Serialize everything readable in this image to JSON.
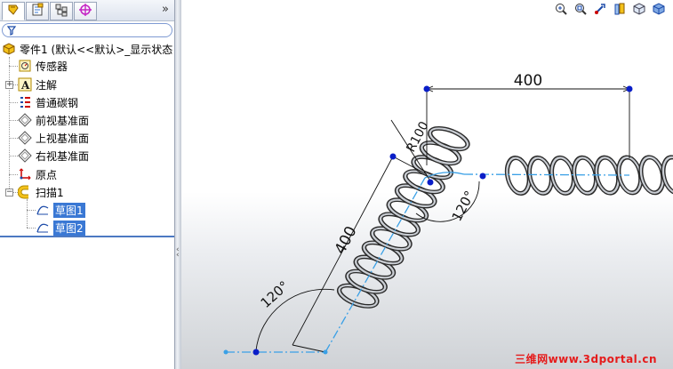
{
  "tabs": [
    {
      "name": "featuremanager-tab",
      "icon": "feature-tree-icon",
      "active": true
    },
    {
      "name": "propertymanager-tab",
      "icon": "property-manager-icon",
      "active": false
    },
    {
      "name": "configuration-tab",
      "icon": "configuration-manager-icon",
      "active": false
    },
    {
      "name": "dimxpert-tab",
      "icon": "crosshair-target-icon",
      "active": false
    }
  ],
  "tabs_more": "»",
  "tree": {
    "root": "零件1  (默认<<默认>_显示状态",
    "items": [
      {
        "label": "传感器",
        "icon": "sensor-icon"
      },
      {
        "label": "注解",
        "icon": "annotation-icon"
      },
      {
        "label": "普通碳钢",
        "icon": "material-icon"
      },
      {
        "label": "前视基准面",
        "icon": "plane-icon"
      },
      {
        "label": "上视基准面",
        "icon": "plane-icon"
      },
      {
        "label": "右视基准面",
        "icon": "plane-icon"
      },
      {
        "label": "原点",
        "icon": "origin-icon"
      },
      {
        "label": "扫描1",
        "icon": "sweep-icon"
      }
    ],
    "children": [
      {
        "label": "草图1",
        "icon": "sketch-icon",
        "selected": true
      },
      {
        "label": "草图2",
        "icon": "sketch-icon",
        "selected": true
      }
    ]
  },
  "view_toolbar": [
    "zoom-to-fit-icon",
    "zoom-area-icon",
    "previous-view-icon",
    "section-view-icon",
    "view-orientation-icon",
    "display-style-icon"
  ],
  "dimensions": {
    "top_length": "400",
    "angled_length": "400",
    "radius": "R100",
    "bend_angle": "120°",
    "base_angle": "120°"
  },
  "accent_colors": {
    "dimension_point": "#0a1ec8",
    "path_line": "#3aa0e6",
    "selection": "#3a78d4",
    "watermark": "#e51b1b"
  },
  "watermark": "三维网www.3dportal.cn"
}
